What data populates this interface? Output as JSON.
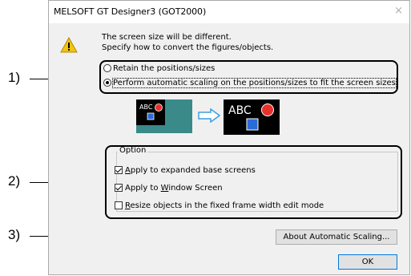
{
  "dialog": {
    "title": "MELSOFT GT Designer3 (GOT2000)",
    "close_glyph": "×",
    "message_line1": "The screen size will be different.",
    "message_line2": "Specify how to convert the figures/objects."
  },
  "scaling_options": {
    "retain_label": "Retain the positions/sizes",
    "auto_label": "Perform automatic scaling on the positions/sizes to fit the screen sizes",
    "selected": "auto"
  },
  "preview": {
    "before_text": "ABC",
    "after_text": "ABC",
    "colors": {
      "screen_before_bg": "#3a8a8a",
      "screen_bg": "#000000",
      "lamp": "#e8312a",
      "switch": "#2a6bd6",
      "arrow": "#3aa0e0"
    }
  },
  "option_group": {
    "label": "Option",
    "items": [
      {
        "label_prefix": "",
        "label_accel": "A",
        "label_rest": "pply to expanded base screens",
        "checked": true
      },
      {
        "label_prefix": "Apply to ",
        "label_accel": "W",
        "label_rest": "indow Screen",
        "checked": true
      },
      {
        "label_prefix": "",
        "label_accel": "R",
        "label_rest": "esize objects in the fixed frame width edit mode",
        "checked": false
      }
    ]
  },
  "buttons": {
    "about_label": "About Automatic Scaling...",
    "ok_label": "OK"
  },
  "annotations": [
    "1)",
    "2)",
    "3)"
  ]
}
